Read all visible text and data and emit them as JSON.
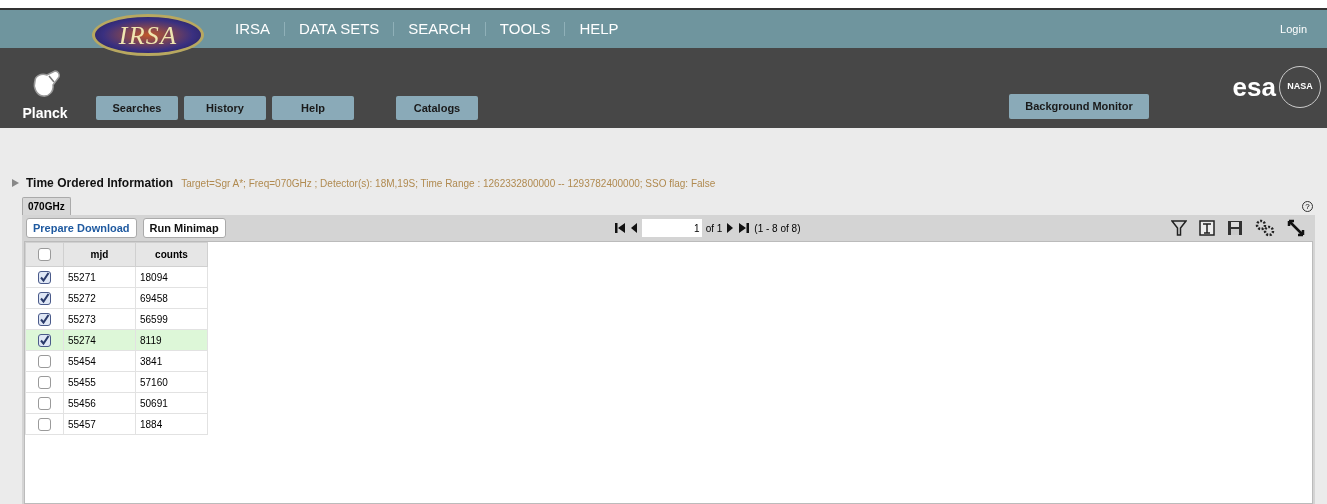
{
  "header": {
    "irsa_logo": "IRSA",
    "nav": [
      "IRSA",
      "DATA SETS",
      "SEARCH",
      "TOOLS",
      "HELP"
    ],
    "login": "Login",
    "mission": "Planck",
    "buttons": [
      "Searches",
      "History",
      "Help",
      "Catalogs"
    ],
    "monitor_button": "Background Monitor",
    "esa_logo": "esa",
    "nasa_logo": "NASA"
  },
  "section": {
    "title": "Time Ordered Information",
    "info": "Target=Sgr A*; Freq=070GHz ; Detector(s): 18M,19S; Time Range : 1262332800000 -- 1293782400000; SSO flag: False",
    "expanded": false
  },
  "tabs": [
    {
      "label": "070GHz",
      "selected": true
    }
  ],
  "help_glyph": "?",
  "toolbar": {
    "buttons": [
      {
        "label": "Prepare Download",
        "kind": "link"
      },
      {
        "label": "Run Minimap",
        "kind": "plain"
      }
    ],
    "page": "1",
    "of": "of 1",
    "range": "(1 - 8 of 8)"
  },
  "table": {
    "header_checked": false,
    "columns": [
      "mjd",
      "counts"
    ],
    "rows": [
      {
        "cells": [
          "55271",
          "18094"
        ],
        "checked": true,
        "selected": false
      },
      {
        "cells": [
          "55272",
          "69458"
        ],
        "checked": true,
        "selected": false
      },
      {
        "cells": [
          "55273",
          "56599"
        ],
        "checked": true,
        "selected": false
      },
      {
        "cells": [
          "55274",
          "8119"
        ],
        "checked": true,
        "selected": true
      },
      {
        "cells": [
          "55454",
          "3841"
        ],
        "checked": false,
        "selected": false
      },
      {
        "cells": [
          "55455",
          "57160"
        ],
        "checked": false,
        "selected": false
      },
      {
        "cells": [
          "55456",
          "50691"
        ],
        "checked": false,
        "selected": false
      },
      {
        "cells": [
          "55457",
          "1884"
        ],
        "checked": false,
        "selected": false
      }
    ]
  }
}
